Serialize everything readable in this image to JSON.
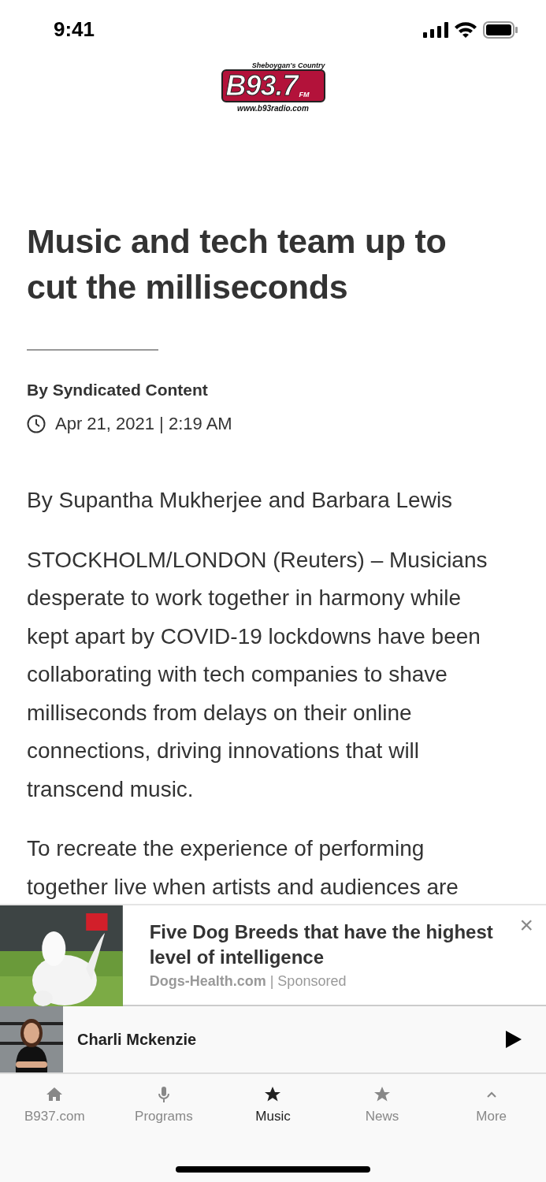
{
  "status_bar": {
    "time": "9:41"
  },
  "logo": {
    "tagline": "Sheboygan's Country",
    "name": "B93.7",
    "band": "FM",
    "url": "www.b93radio.com"
  },
  "article": {
    "title": "Music and tech team up to cut the milliseconds",
    "author": "By Syndicated Content",
    "date": "Apr 21, 2021 | 2:19 AM",
    "paragraphs": [
      "By Supantha Mukherjee and Barbara Lewis",
      "STOCKHOLM/LONDON (Reuters) – Musicians desperate to work together in harmony while kept apart by COVID-19 lockdowns have been collaborating with tech companies to shave milliseconds from delays on their online connections, driving innovations that will transcend music.",
      "To recreate the experience of performing together live when artists and audiences are"
    ]
  },
  "ad": {
    "headline": "Five Dog Breeds that have the highest level of intelligence",
    "source": "Dogs-Health.com",
    "separator": "|",
    "label": "Sponsored",
    "close": "×"
  },
  "player": {
    "host": "Charli Mckenzie"
  },
  "tabs": [
    {
      "label": "B937.com",
      "kind": "home",
      "selected": false
    },
    {
      "label": "Programs",
      "kind": "mic",
      "selected": false
    },
    {
      "label": "Music",
      "kind": "star",
      "selected": true
    },
    {
      "label": "News",
      "kind": "star",
      "selected": false
    },
    {
      "label": "More",
      "kind": "chevron",
      "selected": false
    }
  ]
}
